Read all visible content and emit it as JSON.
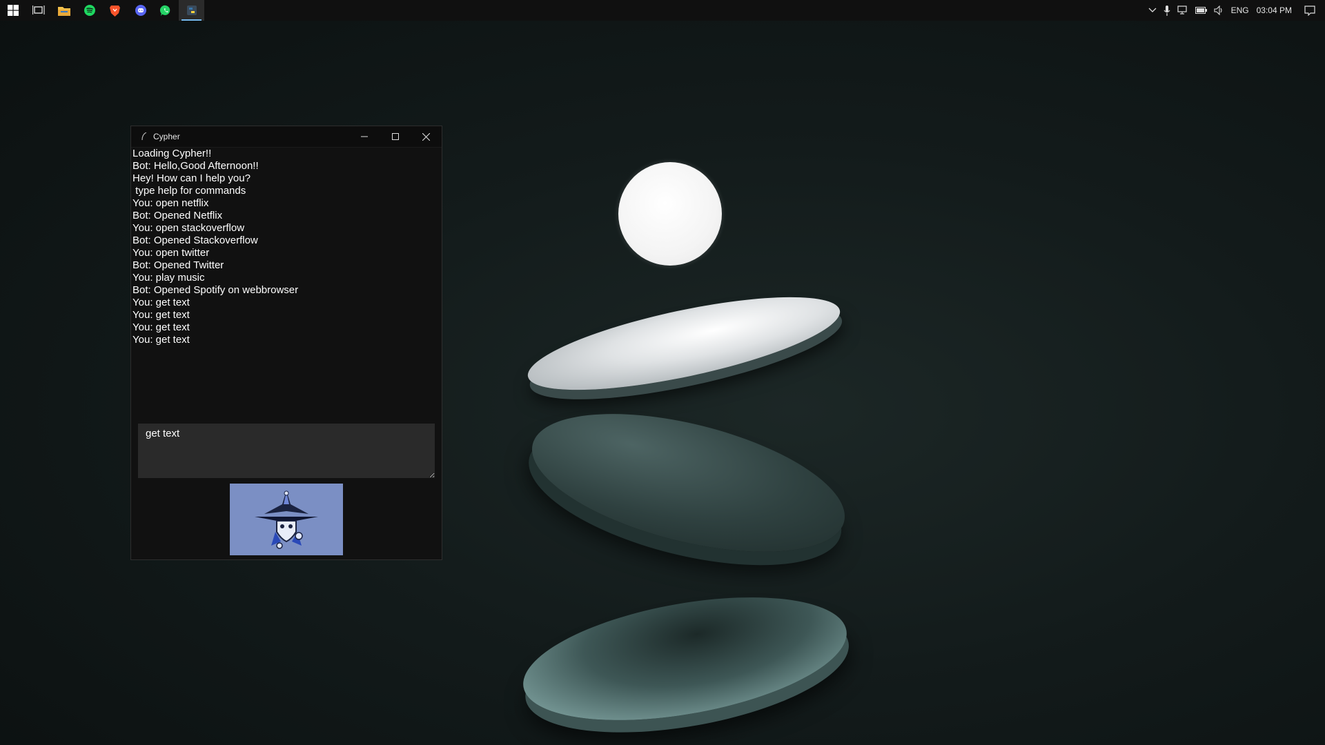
{
  "taskbar": {
    "apps": [
      {
        "name": "start-icon"
      },
      {
        "name": "task-view-icon"
      },
      {
        "name": "file-explorer-icon"
      },
      {
        "name": "spotify-icon"
      },
      {
        "name": "brave-icon"
      },
      {
        "name": "discord-icon"
      },
      {
        "name": "whatsapp-icon"
      },
      {
        "name": "cypher-python-icon",
        "active": true
      }
    ],
    "tray": {
      "language": "ENG",
      "time": "03:04 PM"
    }
  },
  "window": {
    "title": "Cypher",
    "chat_lines": [
      "Loading Cypher!!",
      "Bot: Hello,Good Afternoon!!",
      "Hey! How can I help you?",
      " type help for commands",
      "You: open netflix",
      "Bot: Opened Netflix",
      "You: open stackoverflow",
      "Bot: Opened Stackoverflow",
      "You: open twitter",
      "Bot: Opened Twitter",
      "You: play music",
      "Bot: Opened Spotify on webbrowser",
      "You: get text",
      "You: get text",
      "You: get text",
      "You: get text"
    ],
    "input_value": "get text"
  },
  "colors": {
    "taskbar_bg": "#101010",
    "window_bg": "#111111",
    "input_bg": "#2a2a2a",
    "logo_bg": "#7b8fc4",
    "taskbar_accent": "#76b9ed"
  }
}
